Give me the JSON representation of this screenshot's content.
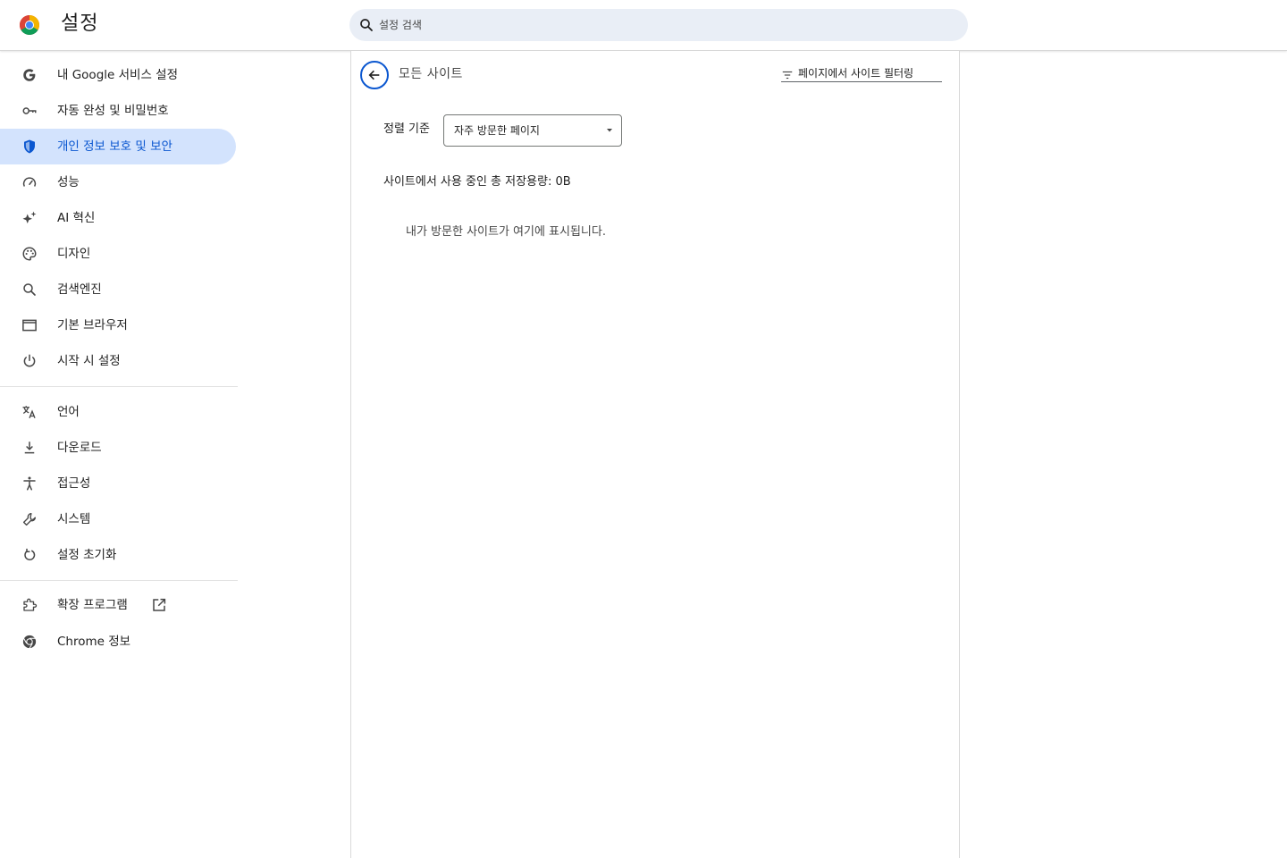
{
  "header": {
    "title": "설정",
    "search": {
      "placeholder": "설정 검색",
      "value": ""
    }
  },
  "sidebar": {
    "items": [
      {
        "label": "내 Google 서비스 설정",
        "icon": "google-g-icon"
      },
      {
        "label": "자동 완성 및 비밀번호",
        "icon": "key-icon"
      },
      {
        "label": "개인 정보 보호 및 보안",
        "icon": "shield-icon",
        "active": true
      },
      {
        "label": "성능",
        "icon": "speedometer-icon"
      },
      {
        "label": "AI 혁신",
        "icon": "sparkle-icon"
      },
      {
        "label": "디자인",
        "icon": "palette-icon"
      },
      {
        "label": "검색엔진",
        "icon": "search-icon"
      },
      {
        "label": "기본 브라우저",
        "icon": "browser-window-icon"
      },
      {
        "label": "시작 시 설정",
        "icon": "power-icon"
      },
      {
        "label": "언어",
        "icon": "translate-icon"
      },
      {
        "label": "다운로드",
        "icon": "download-icon"
      },
      {
        "label": "접근성",
        "icon": "accessibility-icon"
      },
      {
        "label": "시스템",
        "icon": "wrench-icon"
      },
      {
        "label": "설정 초기화",
        "icon": "reset-icon"
      },
      {
        "label": "확장 프로그램",
        "icon": "extension-icon",
        "external": true
      },
      {
        "label": "Chrome 정보",
        "icon": "chrome-icon"
      }
    ]
  },
  "main": {
    "page_title": "모든 사이트",
    "filter": {
      "placeholder": "페이지에서 사이트 필터링",
      "value": ""
    },
    "sort": {
      "label": "정렬 기준",
      "selected": "자주 방문한 페이지"
    },
    "storage_summary": "사이트에서 사용 중인 총 저장용량: 0B",
    "empty_message": "내가 방문한 사이트가 여기에 표시됩니다."
  },
  "colors": {
    "accent": "#0b57d0",
    "active_nav_bg": "#d3e3fd",
    "search_bg": "#e9eef6",
    "icon_gray": "#474747"
  }
}
